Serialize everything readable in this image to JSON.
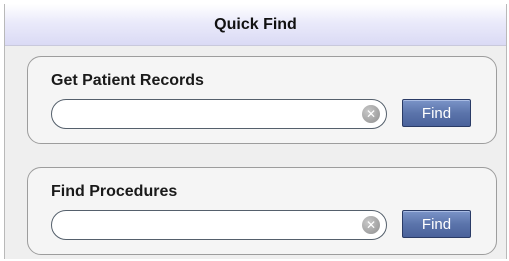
{
  "header": {
    "title": "Quick Find"
  },
  "sections": [
    {
      "title": "Get Patient Records",
      "input_value": "",
      "clear_icon": "clear-icon",
      "button_label": "Find"
    },
    {
      "title": "Find Procedures",
      "input_value": "",
      "clear_icon": "clear-icon",
      "button_label": "Find"
    }
  ],
  "colors": {
    "button": "#5b74ab",
    "header_gradient_end": "#dadaf5",
    "panel_background": "#efefef"
  }
}
